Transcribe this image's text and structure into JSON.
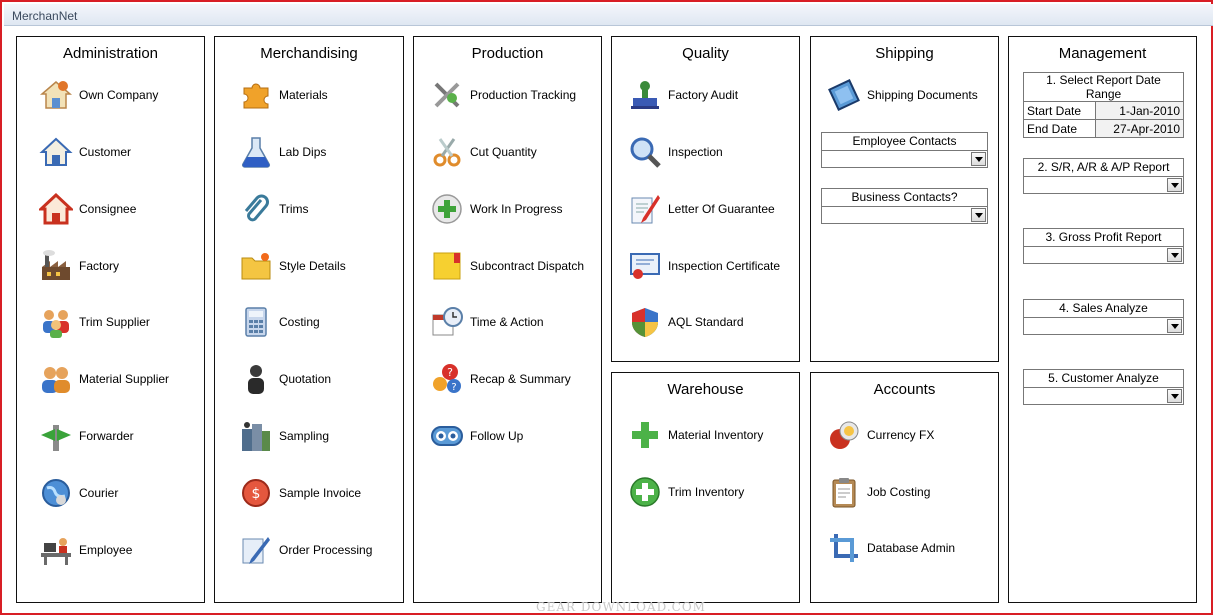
{
  "window": {
    "title": "MerchanNet"
  },
  "administration": {
    "title": "Administration",
    "items": [
      {
        "label": "Own Company",
        "icon": "house-user-icon"
      },
      {
        "label": "Customer",
        "icon": "house-icon"
      },
      {
        "label": "Consignee",
        "icon": "house-red-icon"
      },
      {
        "label": "Factory",
        "icon": "factory-icon"
      },
      {
        "label": "Trim Supplier",
        "icon": "users-group-icon"
      },
      {
        "label": "Material Supplier",
        "icon": "users-pair-icon"
      },
      {
        "label": "Forwarder",
        "icon": "forwarder-icon"
      },
      {
        "label": "Courier",
        "icon": "globe-icon"
      },
      {
        "label": "Employee",
        "icon": "employee-desk-icon"
      }
    ]
  },
  "merchandising": {
    "title": "Merchandising",
    "items": [
      {
        "label": "Materials",
        "icon": "puzzle-icon"
      },
      {
        "label": "Lab Dips",
        "icon": "flask-icon"
      },
      {
        "label": "Trims",
        "icon": "paperclip-icon"
      },
      {
        "label": "Style Details",
        "icon": "folder-star-icon"
      },
      {
        "label": "Costing",
        "icon": "calculator-icon"
      },
      {
        "label": "Quotation",
        "icon": "person-icon"
      },
      {
        "label": "Sampling",
        "icon": "sampling-icon"
      },
      {
        "label": "Sample Invoice",
        "icon": "invoice-icon"
      },
      {
        "label": "Order Processing",
        "icon": "pen-icon"
      }
    ]
  },
  "production": {
    "title": "Production",
    "items": [
      {
        "label": "Production Tracking",
        "icon": "tools-icon"
      },
      {
        "label": "Cut Quantity",
        "icon": "scissors-icon"
      },
      {
        "label": "Work In Progress",
        "icon": "plus-circle-icon"
      },
      {
        "label": "Subcontract Dispatch",
        "icon": "folder-icon"
      },
      {
        "label": "Time & Action",
        "icon": "calendar-clock-icon"
      },
      {
        "label": "Recap & Summary",
        "icon": "question-icon"
      },
      {
        "label": "Follow Up",
        "icon": "follow-up-icon"
      }
    ]
  },
  "quality": {
    "title": "Quality",
    "items": [
      {
        "label": "Factory Audit",
        "icon": "stamp-icon"
      },
      {
        "label": "Inspection",
        "icon": "magnifier-icon"
      },
      {
        "label": "Letter Of Guarantee",
        "icon": "letter-pen-icon"
      },
      {
        "label": "Inspection Certificate",
        "icon": "certificate-icon"
      },
      {
        "label": "AQL Standard",
        "icon": "shield-icon"
      }
    ]
  },
  "warehouse": {
    "title": "Warehouse",
    "items": [
      {
        "label": "Material Inventory",
        "icon": "green-plus-icon"
      },
      {
        "label": "Trim Inventory",
        "icon": "green-plus-circle-icon"
      }
    ]
  },
  "shipping": {
    "title": "Shipping",
    "items": [
      {
        "label": "Shipping Documents",
        "icon": "documents-icon"
      }
    ],
    "combos": [
      {
        "label": "Employee Contacts",
        "value": ""
      },
      {
        "label": "Business Contacts?",
        "value": ""
      }
    ]
  },
  "accounts": {
    "title": "Accounts",
    "items": [
      {
        "label": "Currency FX",
        "icon": "currency-icon"
      },
      {
        "label": "Job Costing",
        "icon": "clipboard-icon"
      },
      {
        "label": "Database Admin",
        "icon": "crop-icon"
      }
    ]
  },
  "management": {
    "title": "Management",
    "date_range": {
      "header": "1. Select Report Date Range",
      "start_label": "Start Date",
      "start_value": "1-Jan-2010",
      "end_label": "End Date",
      "end_value": "27-Apr-2010"
    },
    "reports": [
      {
        "label": "2. S/R, A/R & A/P Report",
        "value": ""
      },
      {
        "label": "3. Gross Profit Report",
        "value": ""
      },
      {
        "label": "4. Sales Analyze",
        "value": ""
      },
      {
        "label": "5. Customer Analyze",
        "value": ""
      }
    ]
  },
  "watermark": "GEAR DOWNLOAD.COM",
  "colors": {
    "frame": "#d81e25",
    "border": "#111111"
  }
}
